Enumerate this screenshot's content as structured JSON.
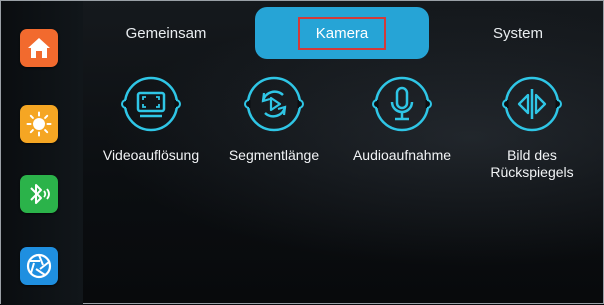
{
  "tabs": [
    {
      "label": "Gemeinsam",
      "active": false
    },
    {
      "label": "Kamera",
      "active": true
    },
    {
      "label": "System",
      "active": false
    }
  ],
  "sidebar": {
    "items": [
      {
        "icon": "home-icon",
        "color": "#f26a2e"
      },
      {
        "icon": "sun-icon",
        "color": "#f5a623"
      },
      {
        "icon": "bluetooth-icon",
        "color": "#2bb34a"
      },
      {
        "icon": "aperture-icon",
        "color": "#1f8fe0"
      }
    ]
  },
  "settings": [
    {
      "label": "Videoauflösung",
      "icon": "screen-resolution-icon"
    },
    {
      "label": "Segmentlänge",
      "icon": "loop-play-icon"
    },
    {
      "label": "Audioaufnahme",
      "icon": "microphone-icon"
    },
    {
      "label": "Bild des\nRückspiegels",
      "icon": "mirror-flip-icon"
    }
  ],
  "colors": {
    "accent": "#26a4d6",
    "highlight_border": "#d33a3a",
    "icon_cyan": "#2fc6e6"
  }
}
